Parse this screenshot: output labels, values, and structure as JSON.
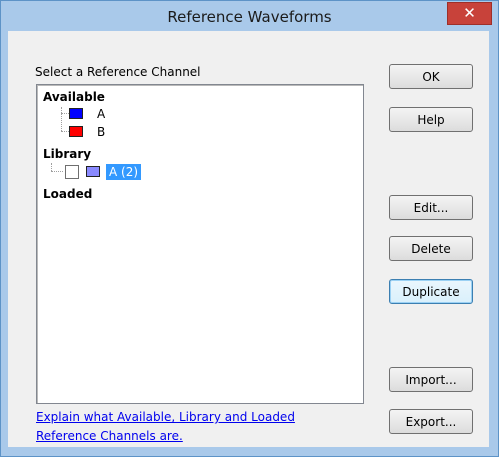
{
  "window": {
    "title": "Reference Waveforms",
    "close_glyph": "✕"
  },
  "group": {
    "label": "Select a Reference Channel"
  },
  "tree": {
    "available": {
      "heading": "Available",
      "items": [
        {
          "label": "A",
          "color": "#0000ff"
        },
        {
          "label": "B",
          "color": "#ff0000"
        }
      ]
    },
    "library": {
      "heading": "Library",
      "items": [
        {
          "label": "A (2)",
          "color": "#8a8aff",
          "selected": true
        }
      ]
    },
    "loaded": {
      "heading": "Loaded"
    }
  },
  "buttons": {
    "ok": "OK",
    "help": "Help",
    "edit": "Edit...",
    "delete": "Delete",
    "duplicate": "Duplicate",
    "import": "Import...",
    "export": "Export..."
  },
  "link": {
    "line1": "Explain what Available, Library and Loaded",
    "line2": "Reference Channels are."
  },
  "icons": {
    "close": "close-icon"
  }
}
